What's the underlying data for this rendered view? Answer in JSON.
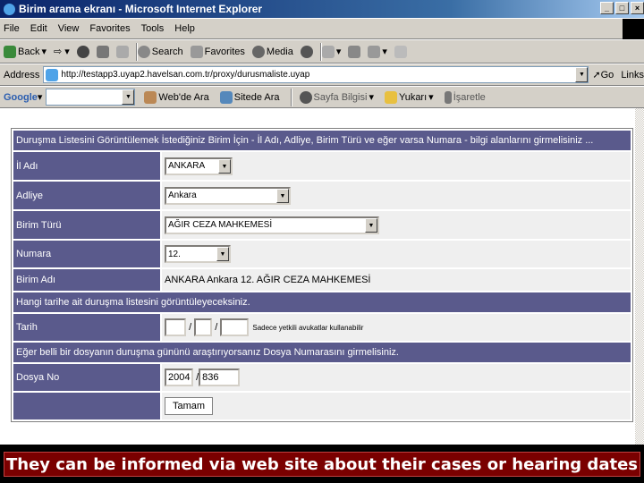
{
  "window": {
    "title": "Birim arama ekranı - Microsoft Internet Explorer",
    "controls": [
      "_",
      "□",
      "×"
    ]
  },
  "menu": [
    "File",
    "Edit",
    "View",
    "Favorites",
    "Tools",
    "Help"
  ],
  "toolbar": {
    "back": "Back",
    "search": "Search",
    "favorites": "Favorites",
    "media": "Media"
  },
  "address": {
    "label": "Address",
    "url": "http://testapp3.uyap2.havelsan.com.tr/proxy/durusmaliste.uyap",
    "go": "Go",
    "links": "Links"
  },
  "google": {
    "logo": "Google",
    "web": "Web'de Ara",
    "site": "Sitede Ara",
    "info": "Sayfa Bilgisi",
    "up": "Yukarı",
    "highlight": "İşaretle"
  },
  "form": {
    "header1": "Duruşma Listesini Görüntülemek İstediğiniz Birim İçin - İl Adı, Adliye, Birim Türü ve eğer varsa Numara - bilgi alanlarını girmelisiniz ...",
    "il_label": "İl Adı",
    "il_value": "ANKARA",
    "adliye_label": "Adliye",
    "adliye_value": "Ankara",
    "birim_turu_label": "Birim Türü",
    "birim_turu_value": "AĞIR CEZA MAHKEMESİ",
    "numara_label": "Numara",
    "numara_value": "12.",
    "birim_adi_label": "Birim Adı",
    "birim_adi_value": "ANKARA Ankara 12. AĞIR CEZA MAHKEMESİ",
    "header2": "Hangi tarihe ait duruşma listesini görüntüleyeceksiniz.",
    "tarih_label": "Tarih",
    "tarih_sep": "/",
    "tarih_note": "Sadece yetkili avukatlar kullanabilir",
    "header3": "Eğer belli bir dosyanın duruşma gününü araştırıyorsanız Dosya Numarasını girmelisiniz.",
    "dosya_label": "Dosya No",
    "dosya_year": "2004",
    "dosya_sep": "/",
    "dosya_num": "836",
    "submit": "Tamam"
  },
  "caption": "They can be  informed via web site about their cases or hearing dates"
}
